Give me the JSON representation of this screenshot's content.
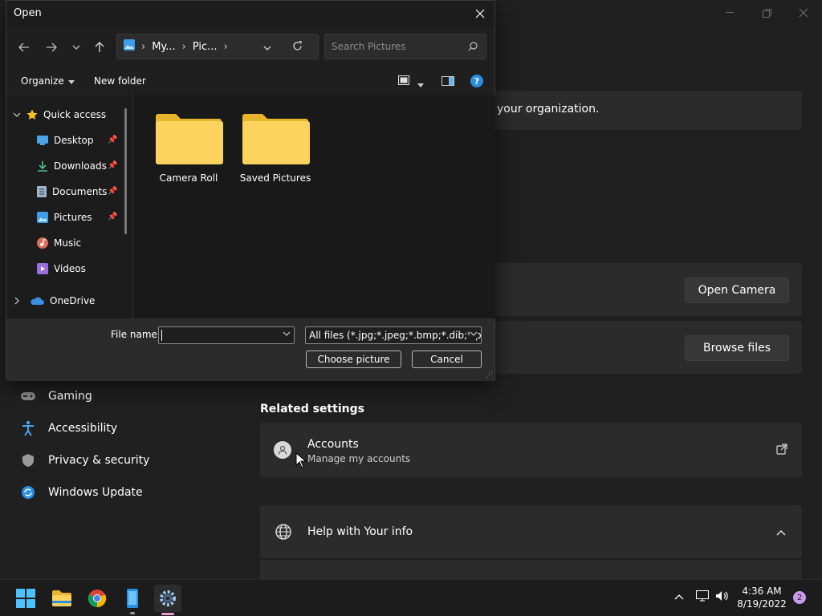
{
  "settings": {
    "org_text": "your organization.",
    "camera_button": "Open Camera",
    "browse_button": "Browse files",
    "related_heading": "Related settings",
    "accounts_title": "Accounts",
    "accounts_sub": "Manage my accounts",
    "help_title": "Help with Your info",
    "nav": [
      {
        "label": "Gaming",
        "icon": "gamepad-icon"
      },
      {
        "label": "Accessibility",
        "icon": "accessibility-icon"
      },
      {
        "label": "Privacy & security",
        "icon": "shield-icon"
      },
      {
        "label": "Windows Update",
        "icon": "update-icon"
      }
    ]
  },
  "dialog": {
    "title": "Open",
    "breadcrumb": [
      "My...",
      "Pic..."
    ],
    "search_placeholder": "Search Pictures",
    "organize_label": "Organize",
    "new_folder_label": "New folder",
    "tree": [
      {
        "label": "Quick access",
        "icon": "star-icon",
        "color": "#f5c518"
      },
      {
        "label": "Desktop",
        "icon": "desktop-icon",
        "color": "#4ca3e6",
        "pinned": true
      },
      {
        "label": "Downloads",
        "icon": "download-icon",
        "color": "#45c48a",
        "pinned": true
      },
      {
        "label": "Documents",
        "icon": "document-icon",
        "color": "#9fb4c8",
        "pinned": true
      },
      {
        "label": "Pictures",
        "icon": "pictures-icon",
        "color": "#3d9de8",
        "pinned": true
      },
      {
        "label": "Music",
        "icon": "music-icon",
        "color": "#e06a5a"
      },
      {
        "label": "Videos",
        "icon": "video-icon",
        "color": "#9b6fe0"
      },
      {
        "label": "OneDrive",
        "icon": "cloud-icon",
        "color": "#3b8ee0"
      }
    ],
    "folders": [
      "Camera Roll",
      "Saved Pictures"
    ],
    "file_name_label": "File name:",
    "file_name_value": "",
    "file_type_value": "All files (*.jpg;*.jpeg;*.bmp;*.dib;*.png",
    "choose_label": "Choose picture",
    "cancel_label": "Cancel"
  },
  "taskbar": {
    "time": "4:36 AM",
    "date": "8/19/2022",
    "notification_count": "2",
    "apps": [
      "start-icon",
      "file-explorer-icon",
      "chrome-icon",
      "phone-icon",
      "settings-icon"
    ]
  }
}
